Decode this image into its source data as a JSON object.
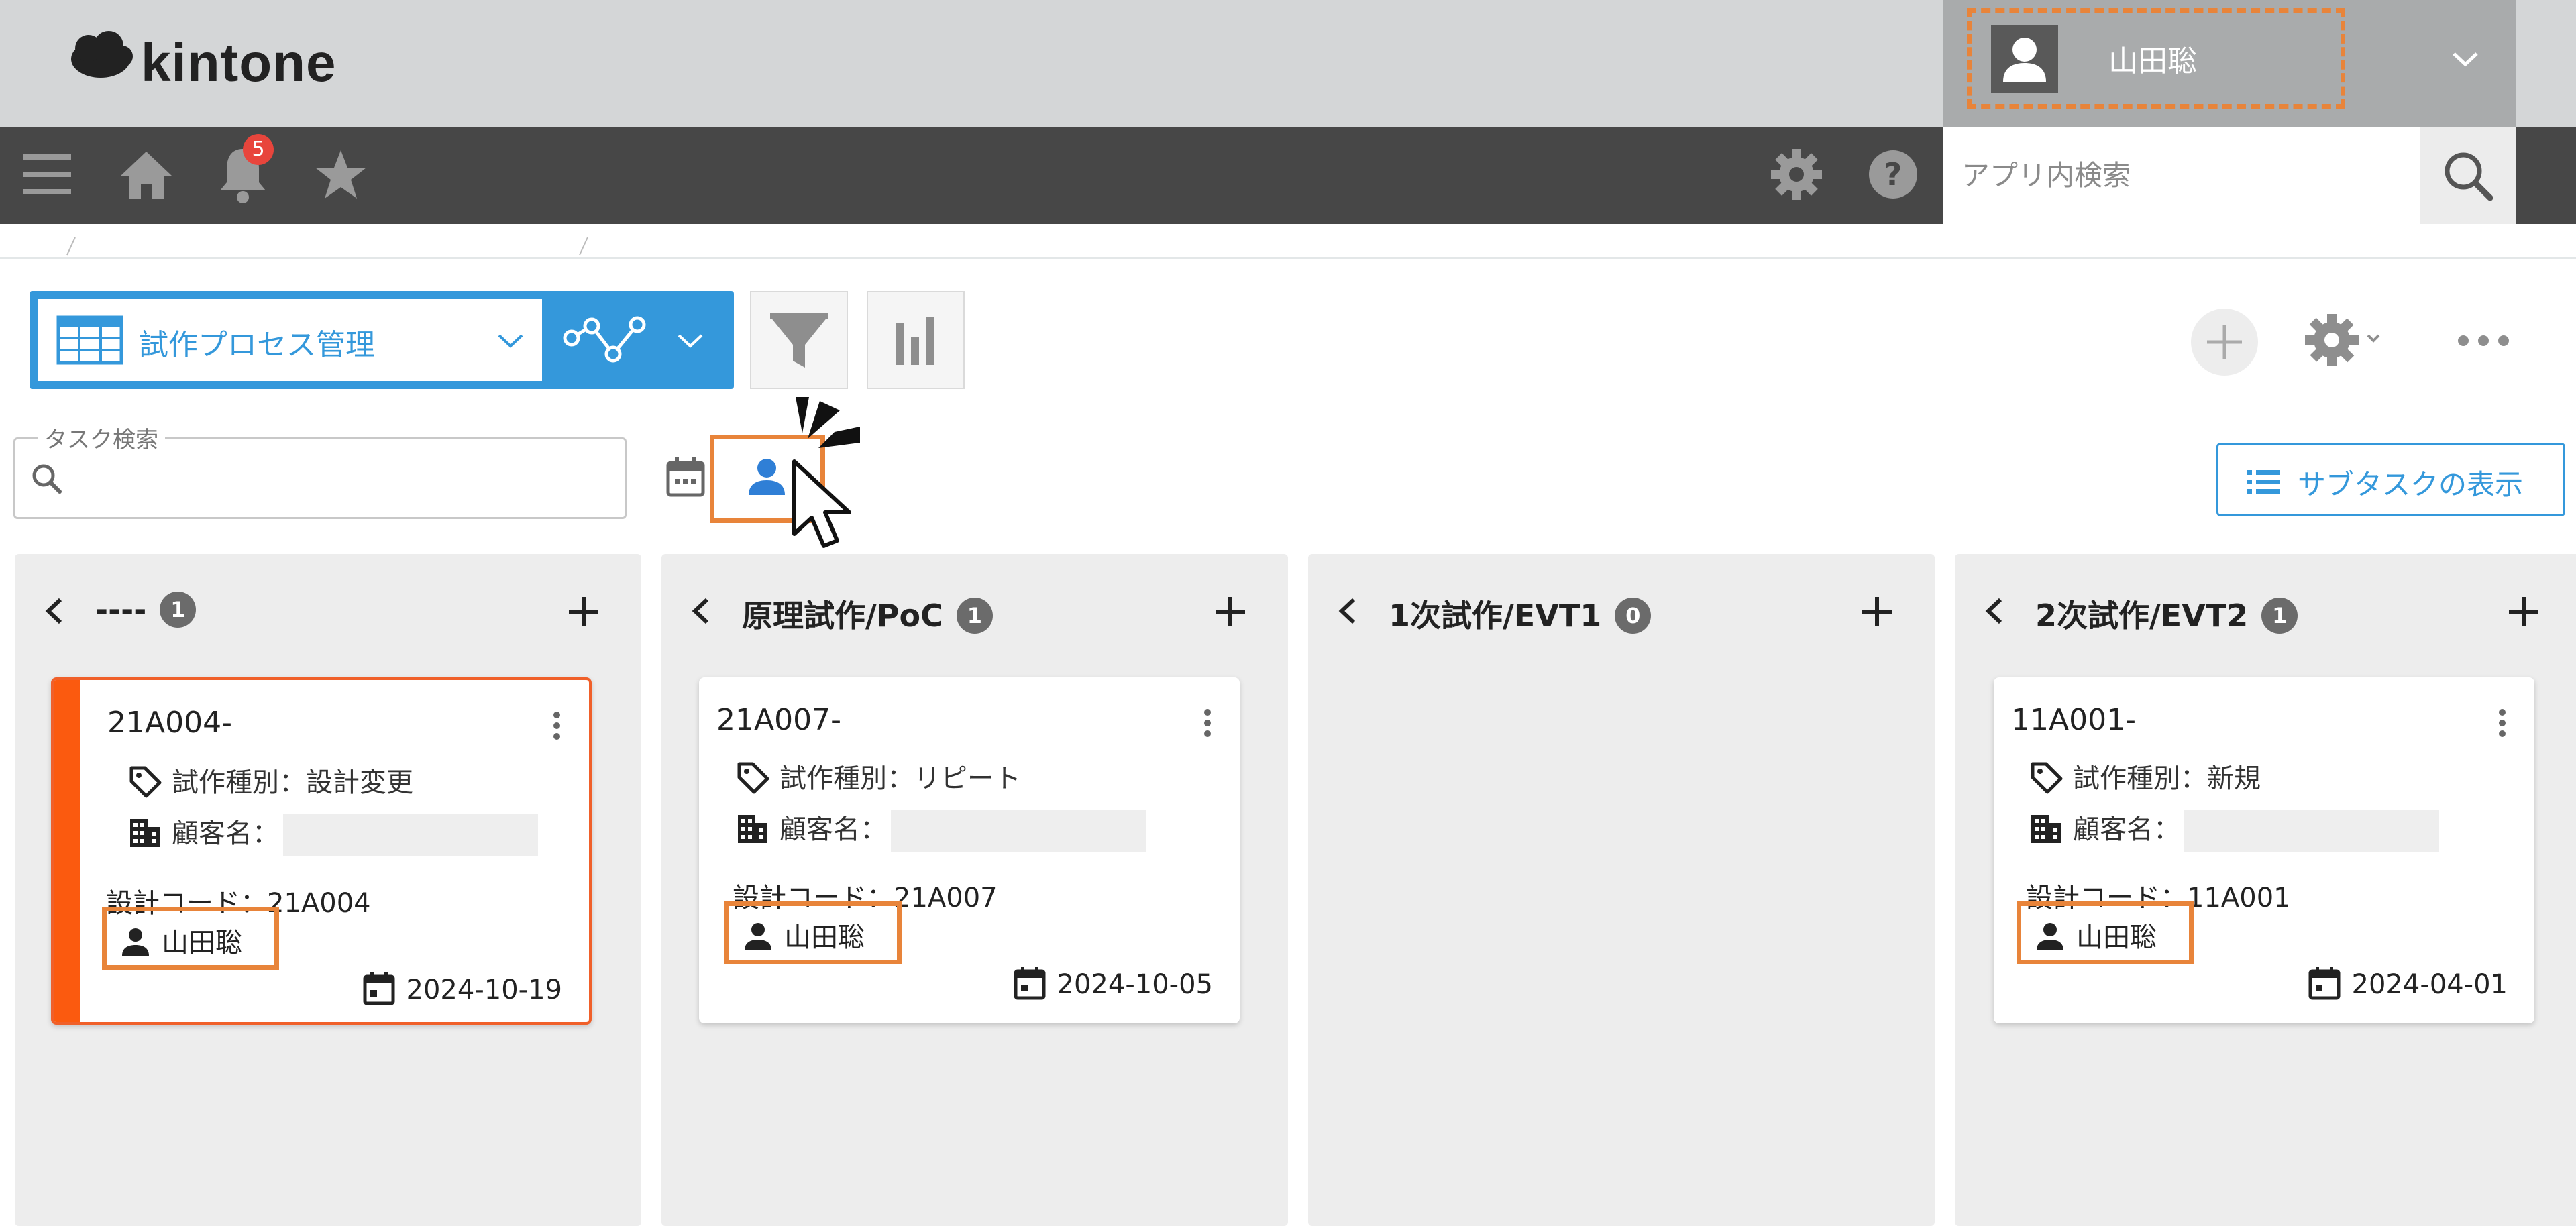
{
  "header": {
    "logo_text": "kintone",
    "user_name": "山田聡",
    "search_placeholder": "アプリ内検索",
    "notification_count": "5"
  },
  "toolbar": {
    "view_name": "試作プロセス管理",
    "task_search_label": "タスク検索",
    "subtask_label": "サブタスクの表示"
  },
  "columns": [
    {
      "title": "----",
      "count": "1",
      "card": {
        "title": "21A004-",
        "type": "試作種別：設計変更",
        "customer": "顧客名：",
        "code": "設計コード：21A004",
        "assignee": "山田聡",
        "due": "2024-10-19"
      }
    },
    {
      "title": "原理試作/PoC",
      "count": "1",
      "card": {
        "title": "21A007-",
        "type": "試作種別：リピート",
        "customer": "顧客名：",
        "code": "設計コード：21A007",
        "assignee": "山田聡",
        "due": "2024-10-05"
      }
    },
    {
      "title": "1次試作/EVT1",
      "count": "0"
    },
    {
      "title": "2次試作/EVT2",
      "count": "1",
      "card": {
        "title": "11A001-",
        "type": "試作種別：新規",
        "customer": "顧客名：",
        "code": "設計コード：11A001",
        "assignee": "山田聡",
        "due": "2024-04-01"
      }
    }
  ],
  "colors": {
    "accent": "#3498db",
    "highlight": "#e8843a",
    "status_stripe": "#fb5a0f",
    "navbar": "#474747"
  }
}
